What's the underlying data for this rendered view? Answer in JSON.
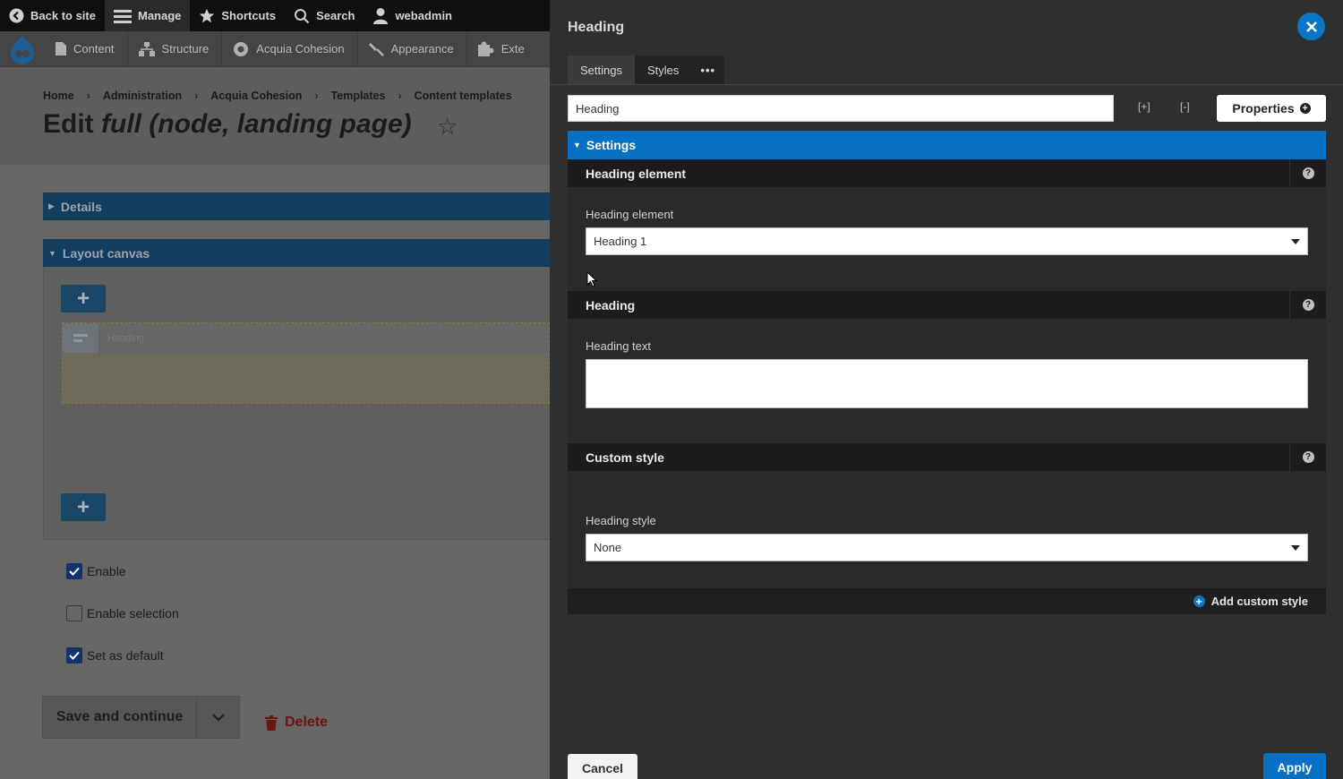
{
  "toolbar": {
    "back_label": "Back to site",
    "manage_label": "Manage",
    "shortcuts_label": "Shortcuts",
    "search_label": "Search",
    "user_label": "webadmin"
  },
  "tray": {
    "items": [
      "Content",
      "Structure",
      "Acquia Cohesion",
      "Appearance",
      "Exte"
    ]
  },
  "breadcrumb": [
    "Home",
    "Administration",
    "Acquia Cohesion",
    "Templates",
    "Content templates"
  ],
  "page": {
    "title_prefix": "Edit ",
    "title_italic": "full (node, landing page)",
    "details_label": "Details",
    "layout_canvas_label": "Layout canvas",
    "component_label": "Heading",
    "plus_label": "+",
    "checkboxes": [
      {
        "label": "Enable",
        "checked": true
      },
      {
        "label": "Enable selection",
        "checked": false
      },
      {
        "label": "Set as default",
        "checked": true
      }
    ],
    "save_label": "Save and continue",
    "delete_label": "Delete"
  },
  "modal": {
    "title": "Heading",
    "tabs": [
      "Settings",
      "Styles",
      "•••"
    ],
    "name_value": "Heading",
    "expand_icon_label": "[+]",
    "collapse_icon_label": "[-]",
    "properties_label": "Properties",
    "settings_label": "Settings",
    "sections": {
      "heading_element": {
        "title": "Heading element",
        "field_label": "Heading element",
        "value": "Heading 1"
      },
      "heading": {
        "title": "Heading",
        "field_label": "Heading text",
        "value": ""
      },
      "custom_style": {
        "title": "Custom style",
        "field_label": "Heading style",
        "value": "None"
      }
    },
    "help_glyph": "?",
    "add_custom_style_label": "Add custom style",
    "cancel_label": "Cancel",
    "apply_label": "Apply"
  },
  "colors": {
    "accent_blue": "#0670c2",
    "modal_bg": "#2f2f30",
    "section_head": "#1c1c1d",
    "delete_red": "#6d1414"
  }
}
